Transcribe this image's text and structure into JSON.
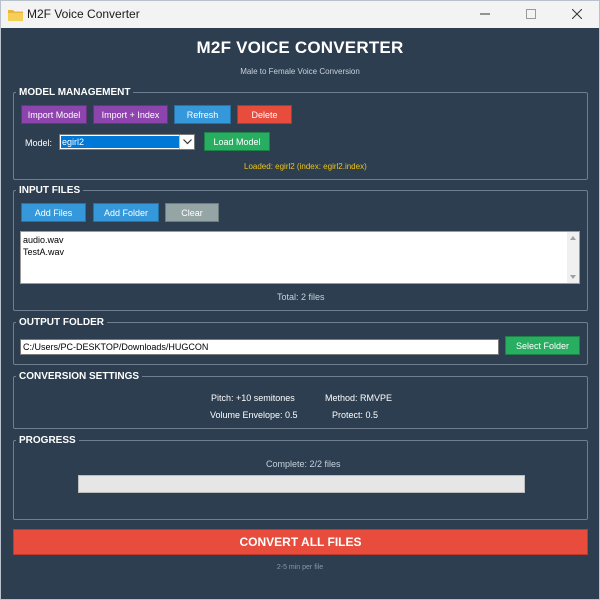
{
  "window": {
    "title": "M2F Voice Converter"
  },
  "header": {
    "title": "M2F VOICE CONVERTER",
    "subtitle": "Male to Female Voice Conversion"
  },
  "model_management": {
    "legend": "MODEL MANAGEMENT",
    "import_model": "Import Model",
    "import_index": "Import + Index",
    "refresh": "Refresh",
    "delete": "Delete",
    "model_label": "Model:",
    "model_value": "egirl2",
    "load_model": "Load Model",
    "loaded_status": "Loaded: egirl2 (index: egirl2.index)"
  },
  "input_files": {
    "legend": "INPUT FILES",
    "add_files": "Add Files",
    "add_folder": "Add Folder",
    "clear": "Clear",
    "files": [
      "audio.wav",
      "TestA.wav"
    ],
    "total": "Total: 2 files"
  },
  "output_folder": {
    "legend": "OUTPUT FOLDER",
    "path": "C:/Users/PC-DESKTOP/Downloads/HUGCON",
    "select_folder": "Select Folder"
  },
  "conversion_settings": {
    "legend": "CONVERSION SETTINGS",
    "pitch": "Pitch: +10 semitones",
    "method": "Method: RMVPE",
    "volume_envelope": "Volume Envelope: 0.5",
    "protect": "Protect: 0.5"
  },
  "progress": {
    "legend": "PROGRESS",
    "status": "Complete: 2/2 files",
    "fraction": 1.0
  },
  "convert": {
    "label": "CONVERT ALL FILES",
    "note": "2-5 min per file"
  },
  "colors": {
    "background": "#2c3e50",
    "purple": "#8e44ad",
    "blue": "#3498db",
    "red": "#e74c3c",
    "green": "#27ae60",
    "gray": "#95a5a6",
    "status_yellow": "#f1c40f"
  }
}
